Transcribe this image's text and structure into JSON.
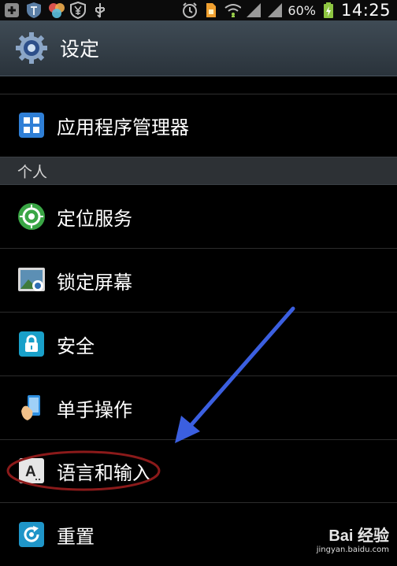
{
  "status_bar": {
    "battery_percent": "60%",
    "time": "14:25"
  },
  "header": {
    "title": "设定",
    "icon": "gear-icon"
  },
  "items": [
    {
      "label": "应用程序管理器",
      "icon": "grid-icon"
    },
    {
      "label": "定位服务",
      "icon": "location-icon"
    },
    {
      "label": "锁定屏幕",
      "icon": "lockscreen-icon"
    },
    {
      "label": "安全",
      "icon": "padlock-icon"
    },
    {
      "label": "单手操作",
      "icon": "hand-icon"
    },
    {
      "label": "语言和输入",
      "icon": "keyboard-a-icon"
    },
    {
      "label": "重置",
      "icon": "reset-icon"
    }
  ],
  "section_header": {
    "label": "个人"
  },
  "annotations": {
    "arrow_color": "#3b5fe0",
    "ellipse_color": "#8b1a1a"
  },
  "watermark": {
    "brand": "Bai 经验",
    "url": "jingyan.baidu.com"
  }
}
